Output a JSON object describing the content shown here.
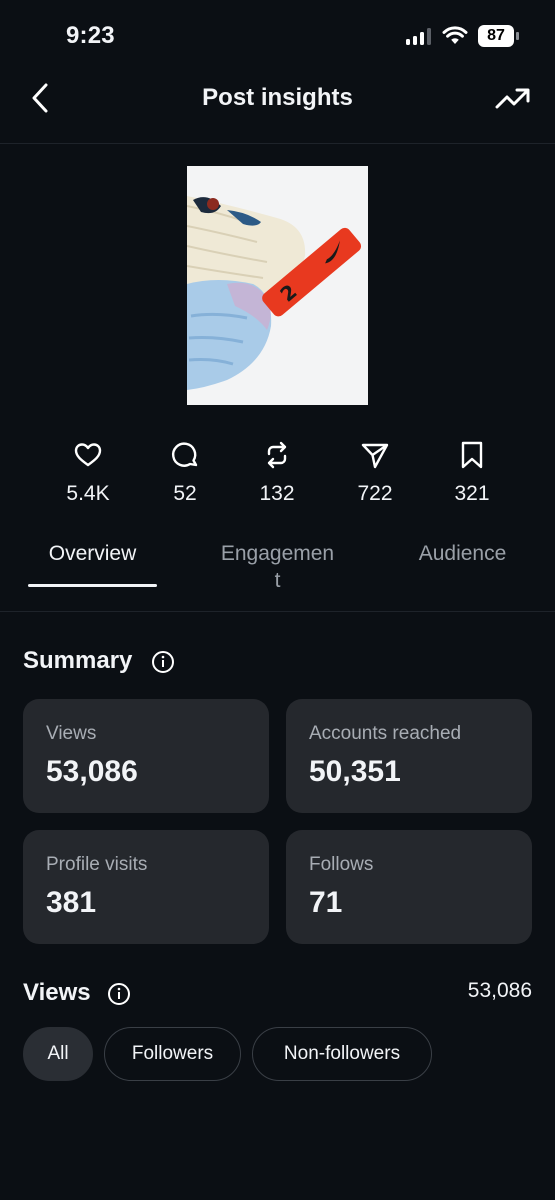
{
  "status_bar": {
    "time": "9:23",
    "battery": "87"
  },
  "header": {
    "title": "Post insights"
  },
  "stats": {
    "likes": "5.4K",
    "comments": "52",
    "reposts": "132",
    "shares": "722",
    "saves": "321"
  },
  "tabs": [
    {
      "label": "Overview",
      "active": true
    },
    {
      "label": "Engagemen\nt",
      "active": false
    },
    {
      "label": "Audience",
      "active": false
    }
  ],
  "summary": {
    "title": "Summary",
    "cards": [
      {
        "label": "Views",
        "value": "53,086"
      },
      {
        "label": "Accounts reached",
        "value": "50,351"
      },
      {
        "label": "Profile visits",
        "value": "381"
      },
      {
        "label": "Follows",
        "value": "71"
      }
    ]
  },
  "views_section": {
    "title": "Views",
    "total": "53,086",
    "filters": [
      {
        "label": "All",
        "active": true
      },
      {
        "label": "Followers",
        "active": false
      },
      {
        "label": "Non-followers",
        "active": false
      }
    ]
  },
  "colors": {
    "background": "#0b0f14",
    "card": "#25282d",
    "accent_red": "#e8391f"
  },
  "icons": [
    "signal-icon",
    "wifi-icon",
    "battery-icon",
    "back-icon",
    "trend-icon",
    "heart-icon",
    "comment-icon",
    "repost-icon",
    "share-icon",
    "bookmark-icon",
    "info-icon"
  ]
}
